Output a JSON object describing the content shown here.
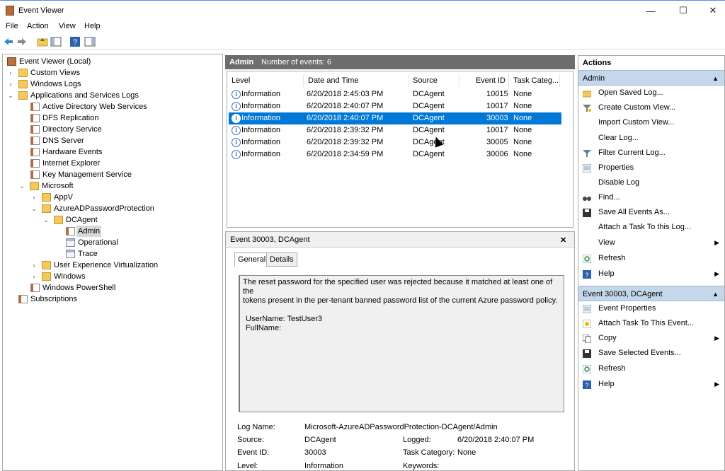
{
  "window": {
    "title": "Event Viewer"
  },
  "controls": {
    "minimize": "—",
    "maximize": "☐",
    "close": "✕"
  },
  "menu": [
    "File",
    "Action",
    "View",
    "Help"
  ],
  "tree": [
    {
      "label": "Event Viewer (Local)",
      "icon": "event-viewer-icon"
    },
    {
      "label": "Custom Views",
      "icon": "folder-icon"
    },
    {
      "label": "Windows Logs",
      "icon": "folder-icon"
    },
    {
      "label": "Applications and Services Logs",
      "icon": "folder-icon"
    },
    {
      "label": "Active Directory Web Services",
      "icon": "log-icon"
    },
    {
      "label": "DFS Replication",
      "icon": "log-icon"
    },
    {
      "label": "Directory Service",
      "icon": "log-icon"
    },
    {
      "label": "DNS Server",
      "icon": "log-icon"
    },
    {
      "label": "Hardware Events",
      "icon": "log-icon"
    },
    {
      "label": "Internet Explorer",
      "icon": "log-icon"
    },
    {
      "label": "Key Management Service",
      "icon": "log-icon"
    },
    {
      "label": "Microsoft",
      "icon": "folder-icon"
    },
    {
      "label": "AppV",
      "icon": "folder-icon"
    },
    {
      "label": "AzureADPasswordProtection",
      "icon": "folder-icon"
    },
    {
      "label": "DCAgent",
      "icon": "folder-icon"
    },
    {
      "label": "Admin",
      "icon": "log-icon"
    },
    {
      "label": "Operational",
      "icon": "doc-icon"
    },
    {
      "label": "Trace",
      "icon": "doc-icon"
    },
    {
      "label": "User Experience Virtualization",
      "icon": "folder-icon"
    },
    {
      "label": "Windows",
      "icon": "folder-icon"
    },
    {
      "label": "Windows PowerShell",
      "icon": "log-icon"
    },
    {
      "label": "Subscriptions",
      "icon": "subscriptions-icon"
    }
  ],
  "log_header": {
    "name": "Admin",
    "count": "Number of events: 6"
  },
  "columns": [
    "Level",
    "Date and Time",
    "Source",
    "Event ID",
    "Task Categ..."
  ],
  "events": [
    {
      "level": "Information",
      "date": "6/20/2018 2:45:03 PM",
      "source": "DCAgent",
      "id": "10015",
      "task": "None"
    },
    {
      "level": "Information",
      "date": "6/20/2018 2:40:07 PM",
      "source": "DCAgent",
      "id": "10017",
      "task": "None"
    },
    {
      "level": "Information",
      "date": "6/20/2018 2:40:07 PM",
      "source": "DCAgent",
      "id": "30003",
      "task": "None"
    },
    {
      "level": "Information",
      "date": "6/20/2018 2:39:32 PM",
      "source": "DCAgent",
      "id": "10017",
      "task": "None"
    },
    {
      "level": "Information",
      "date": "6/20/2018 2:39:32 PM",
      "source": "DCAgent",
      "id": "30005",
      "task": "None"
    },
    {
      "level": "Information",
      "date": "6/20/2018 2:34:59 PM",
      "source": "DCAgent",
      "id": "30006",
      "task": "None"
    }
  ],
  "detail": {
    "title": "Event 30003, DCAgent",
    "close": "✕",
    "tabs": [
      "General",
      "Details"
    ],
    "description_line1": "The reset password for the specified user was rejected because it matched at least one of the",
    "description_line2": "tokens present in the per-tenant banned password list of the current Azure password policy.",
    "username_line": "UserName: TestUser3",
    "fullname_line": "FullName:",
    "fields": {
      "log_name_label": "Log Name:",
      "log_name": "Microsoft-AzureADPasswordProtection-DCAgent/Admin",
      "source_label": "Source:",
      "source": "DCAgent",
      "logged_label": "Logged:",
      "logged": "6/20/2018 2:40:07 PM",
      "event_id_label": "Event ID:",
      "event_id": "30003",
      "task_label": "Task Category:",
      "task": "None",
      "level_label": "Level:",
      "level": "Information",
      "keywords_label": "Keywords:"
    }
  },
  "actions": {
    "header": "Actions",
    "section1": "Admin",
    "items1": [
      {
        "label": "Open Saved Log...",
        "icon": "open-folder-icon"
      },
      {
        "label": "Create Custom View...",
        "icon": "filter-icon"
      },
      {
        "label": "Import Custom View...",
        "icon": ""
      },
      {
        "label": "Clear Log...",
        "icon": ""
      },
      {
        "label": "Filter Current Log...",
        "icon": "filter-icon"
      },
      {
        "label": "Properties",
        "icon": "properties-icon"
      },
      {
        "label": "Disable Log",
        "icon": ""
      },
      {
        "label": "Find...",
        "icon": "binoculars-icon"
      },
      {
        "label": "Save All Events As...",
        "icon": "save-icon"
      },
      {
        "label": "Attach a Task To this Log...",
        "icon": ""
      },
      {
        "label": "View",
        "icon": "",
        "submenu": true
      },
      {
        "label": "Refresh",
        "icon": "refresh-icon"
      },
      {
        "label": "Help",
        "icon": "help-icon",
        "submenu": true
      }
    ],
    "section2": "Event 30003, DCAgent",
    "items2": [
      {
        "label": "Event Properties",
        "icon": "properties-icon"
      },
      {
        "label": "Attach Task To This Event...",
        "icon": "task-icon"
      },
      {
        "label": "Copy",
        "icon": "copy-icon",
        "submenu": true
      },
      {
        "label": "Save Selected Events...",
        "icon": "save-icon"
      },
      {
        "label": "Refresh",
        "icon": "refresh-icon"
      },
      {
        "label": "Help",
        "icon": "help-icon",
        "submenu": true
      }
    ]
  },
  "colors": {
    "accent": "#0078d7",
    "section": "#c5d7ea",
    "panelhead": "#6d6d6d"
  }
}
